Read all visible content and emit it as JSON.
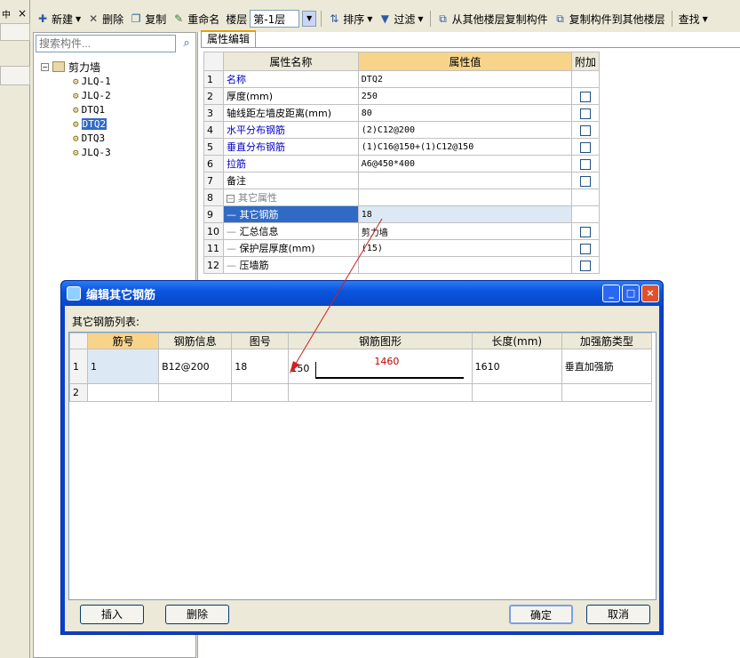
{
  "left_strip": {
    "pin": "中",
    "close": "×"
  },
  "toolbar": {
    "new": "新建",
    "delete": "删除",
    "copy": "复制",
    "rename": "重命名",
    "floor_label": "楼层",
    "floor_value": "第-1层",
    "sort": "排序",
    "filter": "过滤",
    "copy_from_floor": "从其他楼层复制构件",
    "copy_to_floor": "复制构件到其他楼层",
    "find": "查找"
  },
  "tree": {
    "search_placeholder": "搜索构件...",
    "root": "剪力墙",
    "items": [
      "JLQ-1",
      "JLQ-2",
      "DTQ1",
      "DTQ2",
      "DTQ3",
      "JLQ-3"
    ]
  },
  "prop_tab": "属性编辑",
  "prop_grid": {
    "headers": {
      "name": "属性名称",
      "value": "属性值",
      "add": "附加"
    },
    "rows": [
      {
        "num": "1",
        "name": "名称",
        "value": "DTQ2"
      },
      {
        "num": "2",
        "name": "厚度(mm)",
        "value": "250"
      },
      {
        "num": "3",
        "name": "轴线距左墙皮距离(mm)",
        "value": "80"
      },
      {
        "num": "4",
        "name": "水平分布钢筋",
        "value": "(2)C12@200"
      },
      {
        "num": "5",
        "name": "垂直分布钢筋",
        "value": "(1)C16@150+(1)C12@150"
      },
      {
        "num": "6",
        "name": "拉筋",
        "value": "A6@450*400"
      },
      {
        "num": "7",
        "name": "备注",
        "value": ""
      },
      {
        "num": "8",
        "name": "其它属性",
        "value": ""
      },
      {
        "num": "9",
        "name": "其它钢筋",
        "value": "18"
      },
      {
        "num": "10",
        "name": "汇总信息",
        "value": "剪力墙"
      },
      {
        "num": "11",
        "name": "保护层厚度(mm)",
        "value": "(15)"
      },
      {
        "num": "12",
        "name": "压墙筋",
        "value": ""
      }
    ]
  },
  "dialog": {
    "title": "编辑其它钢筋",
    "list_label": "其它钢筋列表:",
    "headers": [
      "筋号",
      "钢筋信息",
      "图号",
      "钢筋图形",
      "长度(mm)",
      "加强筋类型"
    ],
    "rows": [
      {
        "num": "1",
        "jin": "1",
        "info": "B12@200",
        "fig": "18",
        "shape_left": "150",
        "shape_len": "1460",
        "length": "1610",
        "type": "垂直加强筋"
      },
      {
        "num": "2",
        "jin": "",
        "info": "",
        "fig": "",
        "shape_left": "",
        "shape_len": "",
        "length": "",
        "type": ""
      }
    ],
    "buttons": {
      "insert": "插入",
      "delete": "删除",
      "ok": "确定",
      "cancel": "取消"
    },
    "win_min": "_",
    "win_max": "□",
    "win_close": "×"
  }
}
